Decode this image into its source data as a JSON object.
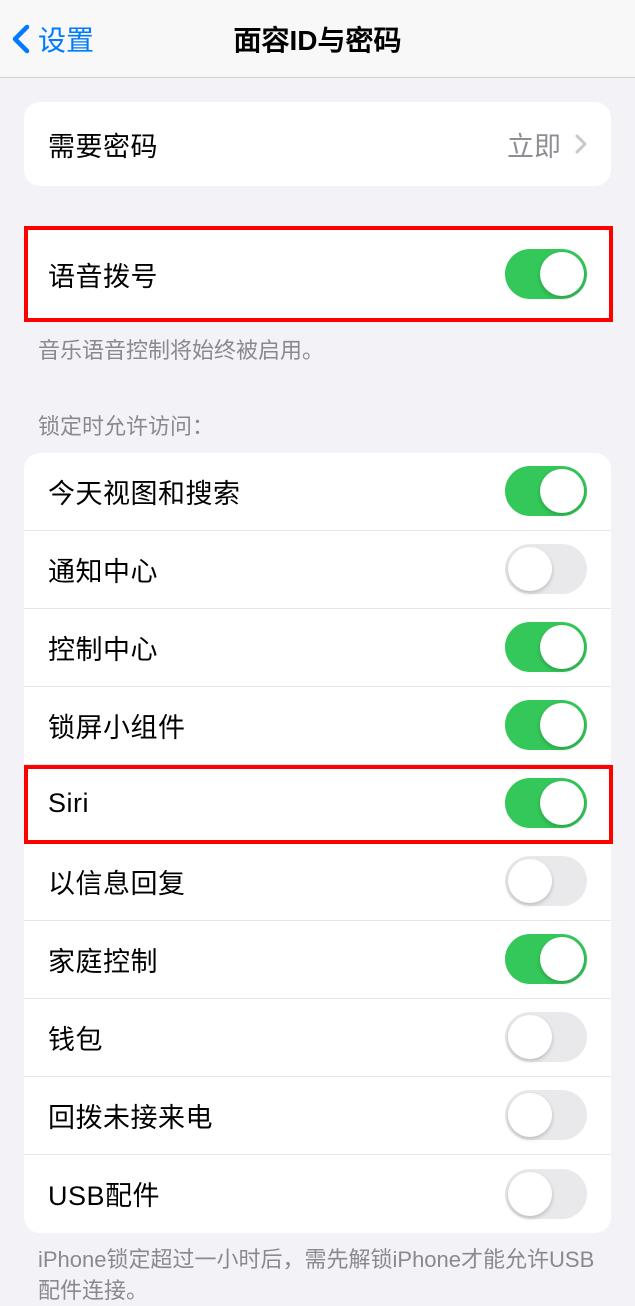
{
  "header": {
    "back_label": "设置",
    "title": "面容ID与密码"
  },
  "require_passcode": {
    "label": "需要密码",
    "value": "立即"
  },
  "voice_dial": {
    "label": "语音拨号",
    "on": true,
    "footer": "音乐语音控制将始终被启用。"
  },
  "lock_section_header": "锁定时允许访问：",
  "lock_items": [
    {
      "label": "今天视图和搜索",
      "on": true
    },
    {
      "label": "通知中心",
      "on": false
    },
    {
      "label": "控制中心",
      "on": true
    },
    {
      "label": "锁屏小组件",
      "on": true
    },
    {
      "label": "Siri",
      "on": true
    },
    {
      "label": "以信息回复",
      "on": false
    },
    {
      "label": "家庭控制",
      "on": true
    },
    {
      "label": "钱包",
      "on": false
    },
    {
      "label": "回拨未接来电",
      "on": false
    },
    {
      "label": "USB配件",
      "on": false
    }
  ],
  "bottom_footer": "iPhone锁定超过一小时后，需先解锁iPhone才能允许USB配件连接。"
}
